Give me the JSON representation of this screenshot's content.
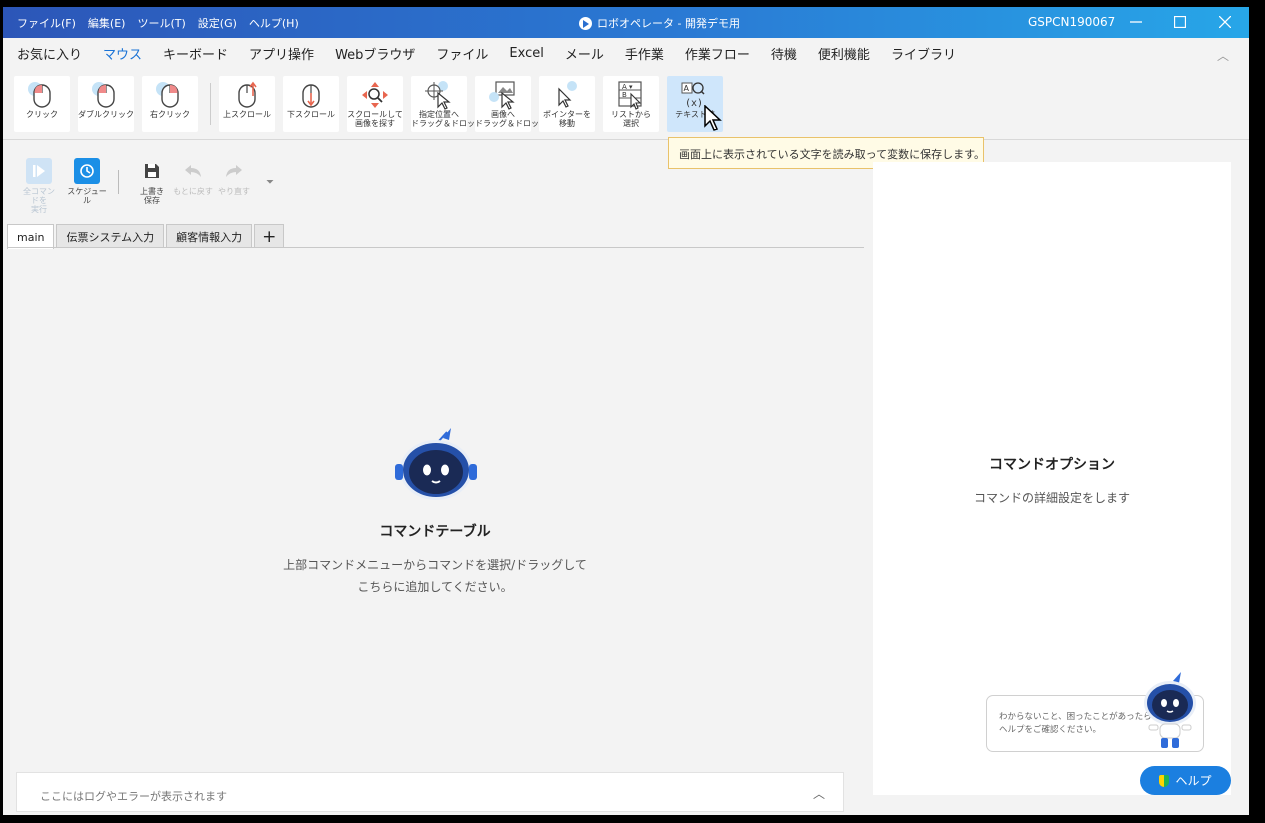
{
  "titlebar": {
    "menus": [
      "ファイル(F)",
      "編集(E)",
      "ツール(T)",
      "設定(G)",
      "ヘルプ(H)"
    ],
    "title": "ロボオペレータ - 開発デモ用",
    "pc_name": "GSPCN190067"
  },
  "ribbon_tabs": [
    "お気に入り",
    "マウス",
    "キーボード",
    "アプリ操作",
    "Webブラウザ",
    "ファイル",
    "Excel",
    "メール",
    "手作業",
    "作業フロー",
    "待機",
    "便利機能",
    "ライブラリ"
  ],
  "active_ribbon_tab": "マウス",
  "ribbon_buttons": [
    {
      "label": "クリック",
      "icon": "mouse-click-icon"
    },
    {
      "label": "ダブルクリック",
      "icon": "mouse-double-click-icon"
    },
    {
      "label": "右クリック",
      "icon": "mouse-right-click-icon"
    },
    {
      "label": "上スクロール",
      "icon": "scroll-up-icon"
    },
    {
      "label": "下スクロール",
      "icon": "scroll-down-icon"
    },
    {
      "label1": "スクロールして",
      "label2": "画像を探す",
      "icon": "scroll-find-image-icon"
    },
    {
      "label1": "指定位置へ",
      "label2": "ドラッグ＆ドロップ",
      "icon": "drag-to-position-icon"
    },
    {
      "label1": "画像へ",
      "label2": "ドラッグ＆ドロップ",
      "icon": "drag-to-image-icon"
    },
    {
      "label1": "ポインターを",
      "label2": "移動",
      "icon": "move-pointer-icon"
    },
    {
      "label1": "リストから",
      "label2": "選択",
      "icon": "select-from-list-icon"
    },
    {
      "label": "テキスト読",
      "icon": "read-text-icon"
    }
  ],
  "tooltip": "画面上に表示されている文字を読み取って変数に保存します。",
  "toolbar": {
    "run_all": "全コマンドを\n実行",
    "run_all_l1": "全コマンドを",
    "run_all_l2": "実行",
    "schedule": "スケジュール",
    "save_l1": "上書き",
    "save_l2": "保存",
    "undo": "もとに戻す",
    "redo": "やり直す"
  },
  "script_tabs": [
    "main",
    "伝票システム入力",
    "顧客情報入力",
    "+"
  ],
  "main": {
    "title": "コマンドテーブル",
    "desc1": "上部コマンドメニューからコマンドを選択/ドラッグして",
    "desc2": "こちらに追加してください。"
  },
  "logbar": {
    "text": "ここにはログやエラーが表示されます"
  },
  "options": {
    "title": "コマンドオプション",
    "desc": "コマンドの詳細設定をします",
    "bubble1": "わからないこと、困ったことがあったら",
    "bubble2": "ヘルプをご確認ください。",
    "help": "ヘルプ"
  },
  "colors": {
    "accent": "#1a73d6",
    "title_start": "#2c56b8",
    "title_end": "#27a6e8",
    "tooltip_bg": "#fffbe6"
  }
}
